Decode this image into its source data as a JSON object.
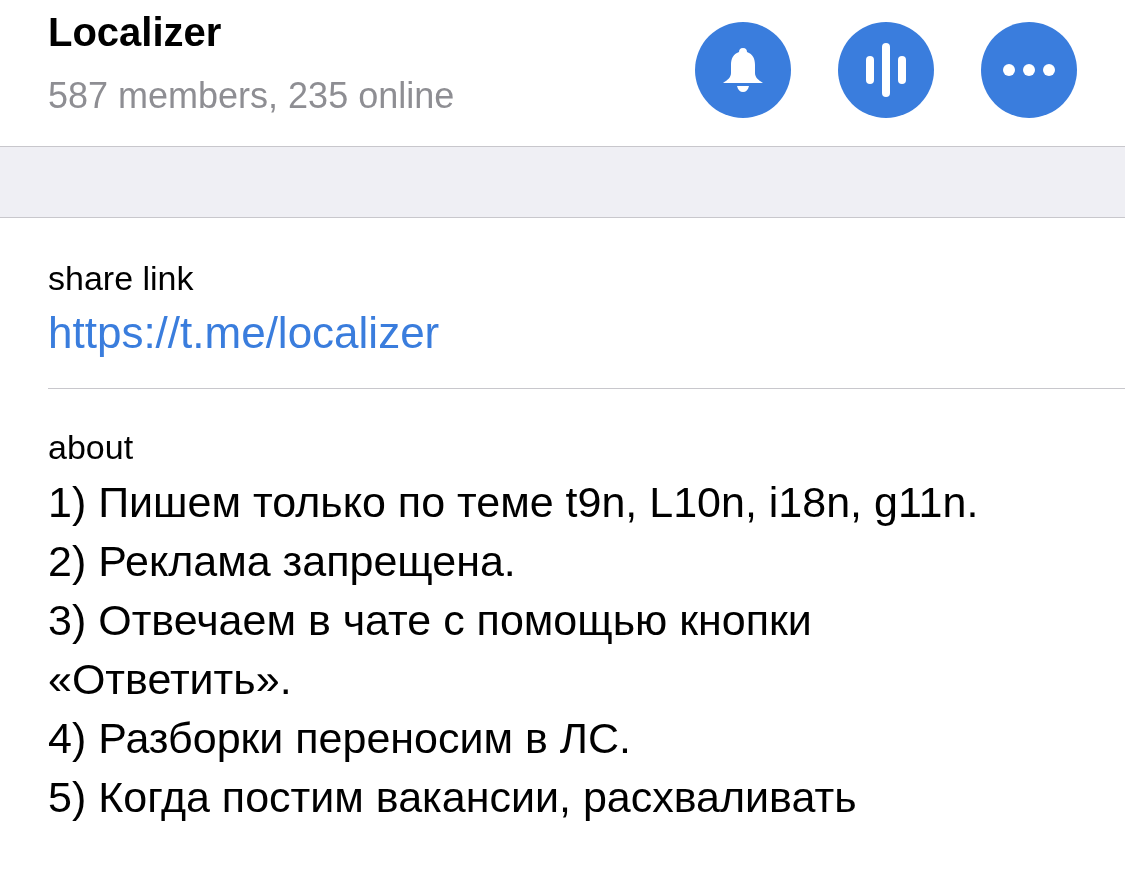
{
  "header": {
    "title": "Localizer",
    "subtitle": "587 members, 235 online",
    "actions": [
      {
        "kind": "bell"
      },
      {
        "kind": "voice"
      },
      {
        "kind": "more"
      }
    ]
  },
  "share": {
    "label": "share link",
    "link": "https://t.me/localizer"
  },
  "about": {
    "label": "about",
    "lines": [
      "1) Пишем только по теме t9n, L10n, i18n, g11n.",
      "2) Реклама запрещена.",
      "3) Отвечаем в чате с помощью кнопки «Ответить».",
      "4) Разборки переносим в ЛС.",
      "5) Когда постим вакансии, расхваливать"
    ]
  }
}
